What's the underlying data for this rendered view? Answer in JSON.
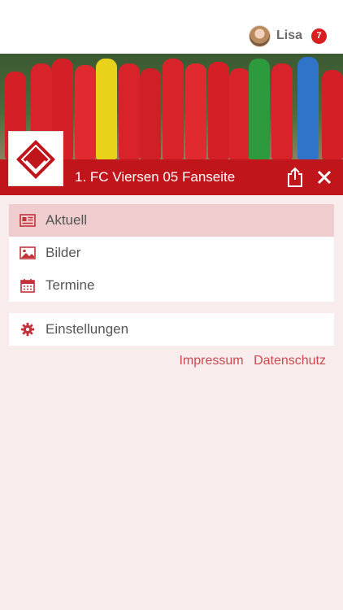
{
  "header": {
    "user_name": "Lisa",
    "notification_count": "7"
  },
  "club": {
    "title": "1. FC Viersen 05 Fanseite"
  },
  "menu": {
    "main": [
      {
        "label": "Aktuell",
        "icon": "newspaper-icon",
        "active": true
      },
      {
        "label": "Bilder",
        "icon": "image-icon",
        "active": false
      },
      {
        "label": "Termine",
        "icon": "calendar-icon",
        "active": false
      }
    ],
    "settings": {
      "label": "Einstellungen",
      "icon": "gear-icon"
    }
  },
  "footer": {
    "impressum": "Impressum",
    "datenschutz": "Datenschutz"
  },
  "colors": {
    "brand_red": "#c0151b",
    "menu_icon": "#c4313a",
    "active_bg": "#efcdce",
    "page_bg": "#f9ecec"
  }
}
